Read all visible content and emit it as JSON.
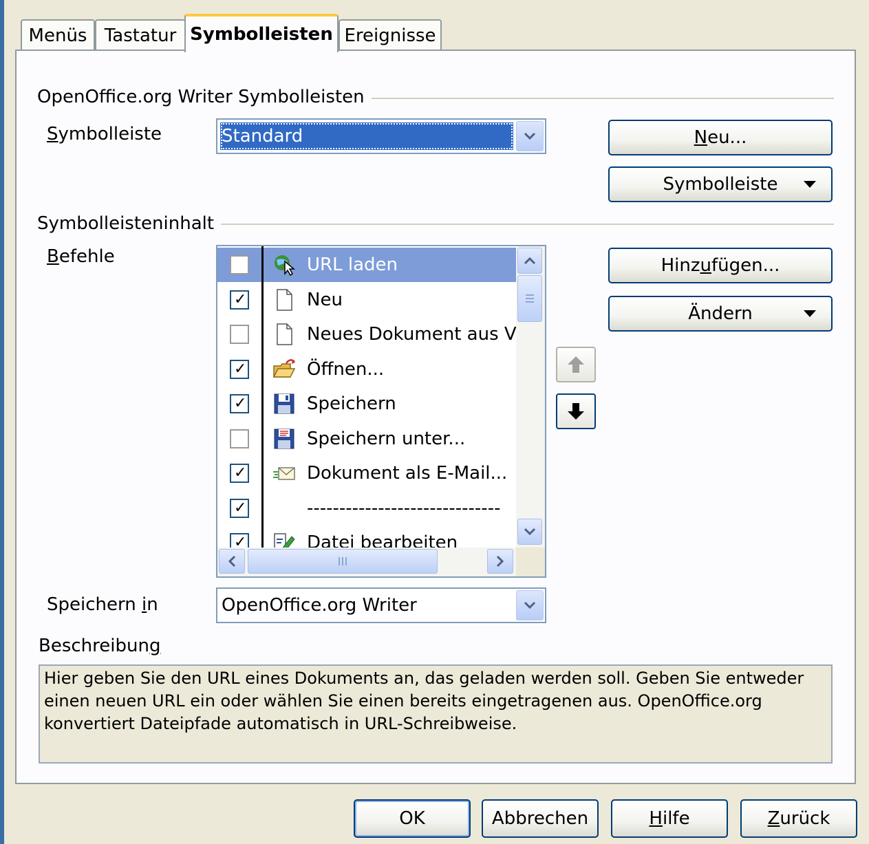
{
  "tabs": [
    {
      "label": "Menüs",
      "active": false
    },
    {
      "label": "Tastatur",
      "active": false
    },
    {
      "label": "Symbolleisten",
      "active": true
    },
    {
      "label": "Ereignisse",
      "active": false
    }
  ],
  "toolbars_group": {
    "title": "OpenOffice.org Writer Symbolleisten",
    "toolbar_label": "Symbolleiste",
    "toolbar_value": "Standard",
    "new_button": "Neu...",
    "toolbar_menu_button": "Symbolleiste"
  },
  "content_group": {
    "title": "Symbolleisteninhalt",
    "commands_label": "Befehle",
    "add_button": "Hinzufügen...",
    "modify_button": "Ändern",
    "commands": [
      {
        "label": "URL laden",
        "checked": false,
        "selected": true,
        "icon": "load-url-icon"
      },
      {
        "label": "Neu",
        "checked": true,
        "selected": false,
        "icon": "new-document-icon"
      },
      {
        "label": "Neues Dokument aus Vorl",
        "checked": false,
        "selected": false,
        "icon": "new-from-template-icon"
      },
      {
        "label": "Öffnen...",
        "checked": true,
        "selected": false,
        "icon": "open-folder-icon"
      },
      {
        "label": "Speichern",
        "checked": true,
        "selected": false,
        "icon": "save-icon"
      },
      {
        "label": "Speichern unter...",
        "checked": false,
        "selected": false,
        "icon": "save-as-icon"
      },
      {
        "label": "Dokument als E-Mail...",
        "checked": true,
        "selected": false,
        "icon": "email-icon"
      },
      {
        "label": "------------------------------",
        "checked": true,
        "selected": false,
        "icon": ""
      },
      {
        "label": "Datei bearbeiten",
        "checked": true,
        "selected": false,
        "icon": "edit-file-icon"
      }
    ]
  },
  "save_in": {
    "label": "Speichern in",
    "value": "OpenOffice.org Writer"
  },
  "description": {
    "label": "Beschreibung",
    "text": "Hier geben Sie den URL eines Dokuments an, das geladen werden soll. Geben Sie entweder einen neuen URL ein oder wählen Sie einen bereits eingetragenen aus. OpenOffice.org konvertiert Dateipfade automatisch in URL-Schreibweise."
  },
  "footer": {
    "ok": "OK",
    "cancel": "Abbrechen",
    "help": "Hilfe",
    "back": "Zurück"
  },
  "colors": {
    "selection": "#7e9cd8",
    "combo_selection": "#316ac5",
    "active_tab_accent": "#ffc83c",
    "button_border": "#003c74"
  }
}
